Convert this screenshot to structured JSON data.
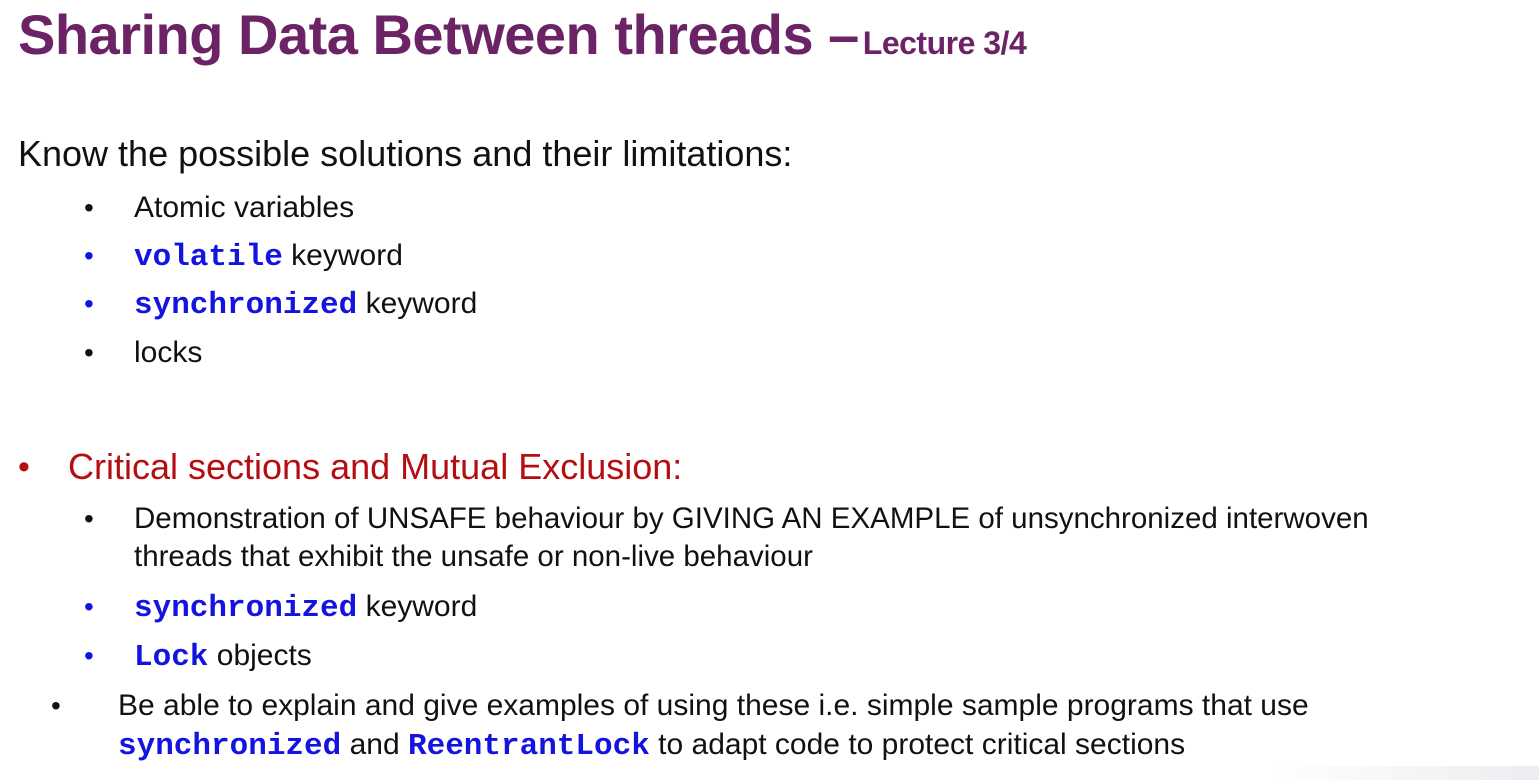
{
  "title": {
    "main": "Sharing Data Between threads –",
    "sub": "Lecture 3/4"
  },
  "intro": "Know the possible solutions and their limitations:",
  "solutions": [
    {
      "code": "",
      "text": "Atomic variables"
    },
    {
      "code": "volatile",
      "text": " keyword"
    },
    {
      "code": "synchronized",
      "text": " keyword"
    },
    {
      "code": "",
      "text": "locks"
    }
  ],
  "critical": {
    "heading": "Critical sections and Mutual Exclusion:",
    "items": {
      "demo_line1": "Demonstration of UNSAFE behaviour by GIVING AN EXAMPLE of unsynchronized interwoven",
      "demo_line2": "threads that exhibit the unsafe or non-live behaviour",
      "sync_code": "synchronized",
      "sync_text": " keyword",
      "lock_code": "Lock",
      "lock_text": " objects"
    }
  },
  "explain": {
    "line1": "Be able to explain and give examples of using these i.e. simple sample programs that use",
    "code1": "synchronized",
    "mid": " and ",
    "code2": "ReentrantLock",
    "end": " to adapt code to protect critical sections"
  },
  "bullet_glyph": "•",
  "colors": {
    "title": "#6b2366",
    "code_blue": "#1414e0",
    "heading_red": "#b40d12",
    "text": "#111111"
  }
}
